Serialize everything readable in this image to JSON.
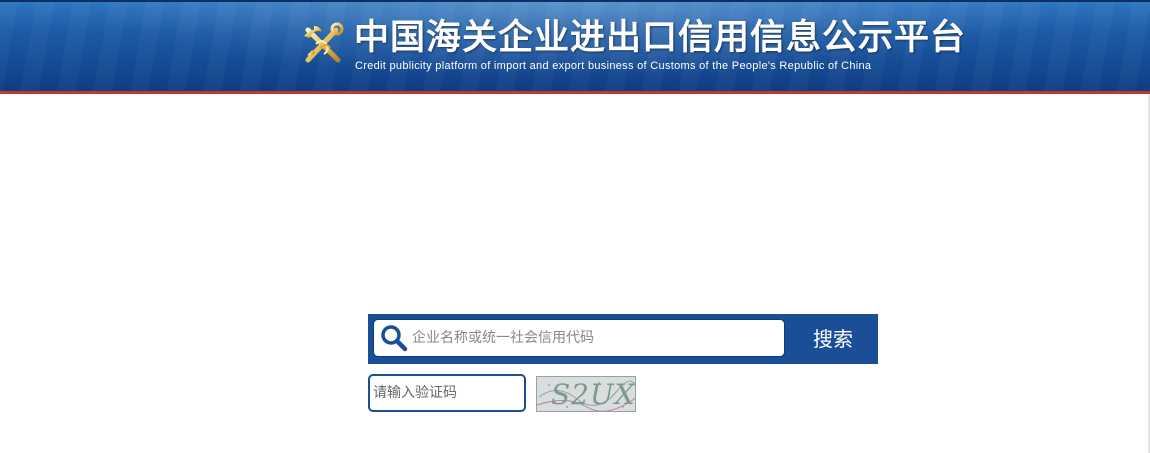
{
  "header": {
    "title_cn": "中国海关企业进出口信用信息公示平台",
    "title_en": "Credit publicity platform of import and export business of Customs of the People's Republic of China",
    "emblem_icon": "customs-emblem-icon",
    "background_color": "#1c5aa6",
    "accent_line_color": "#c0392b"
  },
  "search": {
    "placeholder": "企业名称或统一社会信用代码",
    "value": "",
    "button_label": "搜索",
    "icon": "search-icon",
    "bar_color": "#1a4f97"
  },
  "captcha": {
    "placeholder": "请输入验证码",
    "value": "",
    "image_text": "S2UX"
  }
}
